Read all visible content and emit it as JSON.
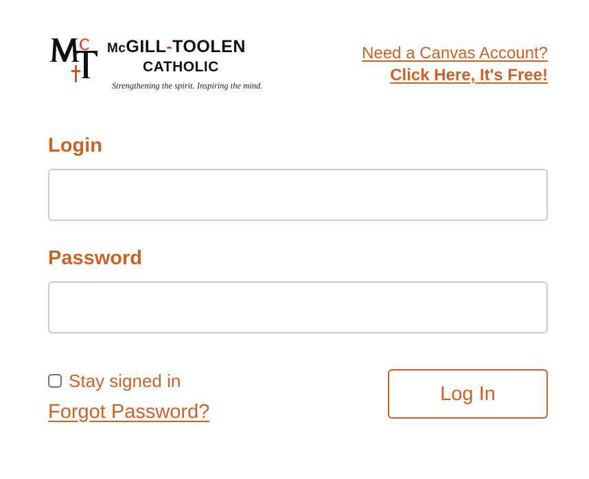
{
  "logo": {
    "monogram_letters": "MT",
    "monogram_small_letter": "c",
    "name_line1_prefix": "Mc",
    "name_line1_part1": "GILL",
    "name_line1_hyphen": "-",
    "name_line1_part2": "TOOLEN",
    "name_line2": "CATHOLIC",
    "tagline": "Strengthening the spirit. Inspiring the mind."
  },
  "account": {
    "need_account": "Need a Canvas Account?",
    "click_here": "Click Here, It's Free!"
  },
  "form": {
    "login_label": "Login",
    "login_value": "",
    "password_label": "Password",
    "password_value": "",
    "stay_signed_in": "Stay signed in",
    "stay_signed_in_checked": false,
    "forgot_password": "Forgot Password?",
    "login_button": "Log In"
  },
  "colors": {
    "accent": "#c8632a",
    "input_border": "#c7cdd1",
    "logo_red": "#d4522a",
    "logo_black": "#111111"
  }
}
